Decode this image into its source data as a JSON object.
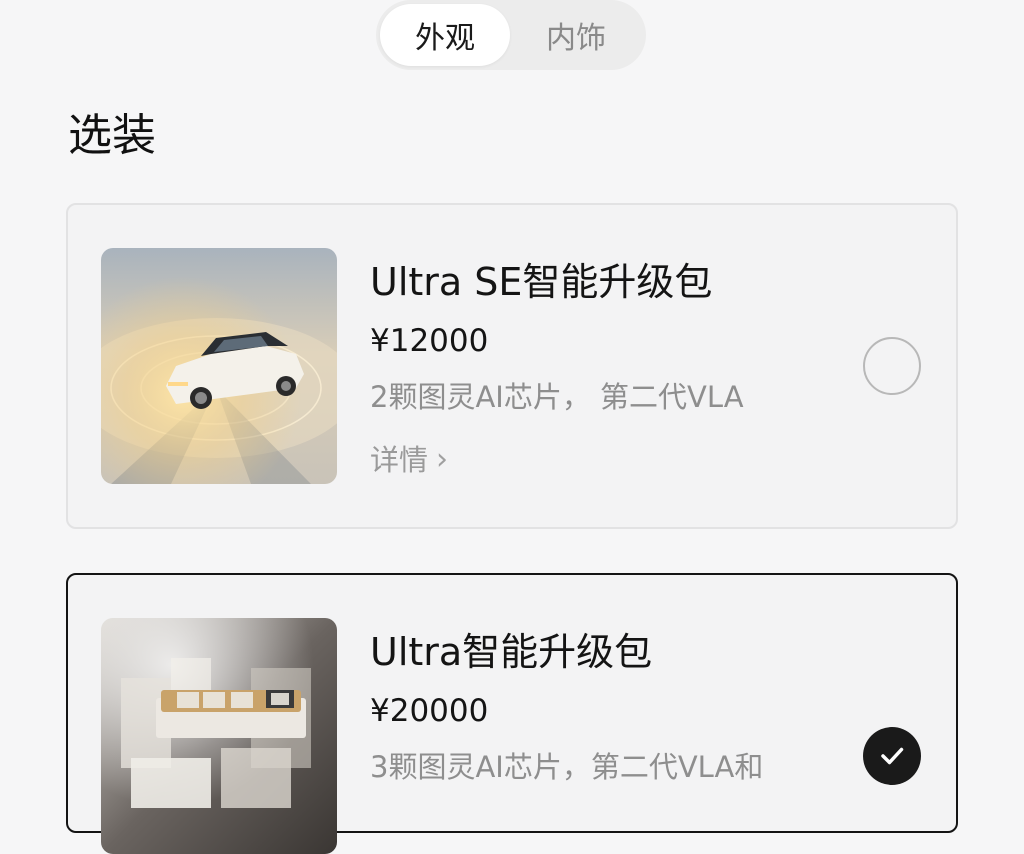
{
  "tabs": [
    {
      "label": "外观",
      "active": true
    },
    {
      "label": "内饰",
      "active": false
    }
  ],
  "section_title": "选装",
  "options": [
    {
      "name": "Ultra SE智能升级包",
      "price": "¥12000",
      "description": "2颗图灵AI芯片， 第二代VLA",
      "detail_label": "详情",
      "selected": false,
      "image": "car-sensor-render"
    },
    {
      "name": "Ultra智能升级包",
      "price": "¥20000",
      "description": "3颗图灵AI芯片，第二代VLA和",
      "selected": true,
      "image": "ai-chip-render"
    }
  ],
  "colors": {
    "background": "#f6f6f7",
    "card_bg": "#f3f3f4",
    "selected_border": "#141414",
    "muted_text": "#8e8e8e"
  }
}
